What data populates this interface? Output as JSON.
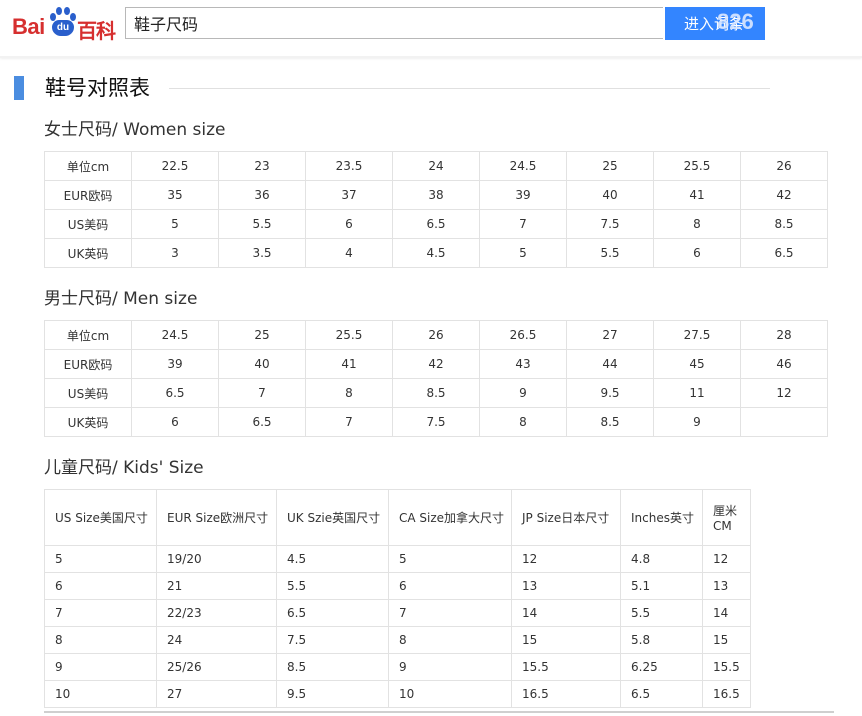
{
  "header": {
    "logo_text_left": "Bai",
    "logo_paw_text": "du",
    "logo_text_right": "百科",
    "search_value": "鞋子尺码",
    "search_button": "进入词条",
    "watermark": "826"
  },
  "section": {
    "title": "鞋号对照表"
  },
  "women": {
    "heading": "女士尺码/ Women size",
    "rows": [
      [
        "单位cm",
        "22.5",
        "23",
        "23.5",
        "24",
        "24.5",
        "25",
        "25.5",
        "26"
      ],
      [
        "EUR欧码",
        "35",
        "36",
        "37",
        "38",
        "39",
        "40",
        "41",
        "42"
      ],
      [
        "US美码",
        "5",
        "5.5",
        "6",
        "6.5",
        "7",
        "7.5",
        "8",
        "8.5"
      ],
      [
        "UK英码",
        "3",
        "3.5",
        "4",
        "4.5",
        "5",
        "5.5",
        "6",
        "6.5"
      ]
    ]
  },
  "men": {
    "heading": "男士尺码/ Men size",
    "rows": [
      [
        "单位cm",
        "24.5",
        "25",
        "25.5",
        "26",
        "26.5",
        "27",
        "27.5",
        "28"
      ],
      [
        "EUR欧码",
        "39",
        "40",
        "41",
        "42",
        "43",
        "44",
        "45",
        "46"
      ],
      [
        "US美码",
        "6.5",
        "7",
        "8",
        "8.5",
        "9",
        "9.5",
        "11",
        "12"
      ],
      [
        "UK英码",
        "6",
        "6.5",
        "7",
        "7.5",
        "8",
        "8.5",
        "9",
        ""
      ]
    ]
  },
  "kids": {
    "heading": "儿童尺码/ Kids' Size",
    "header": [
      "US Size美国尺寸",
      "EUR Size欧洲尺寸",
      "UK Szie英国尺寸",
      "CA Size加拿大尺寸",
      "JP Size日本尺寸",
      "Inches英寸",
      "厘米CM"
    ],
    "rows": [
      [
        "5",
        "19/20",
        "4.5",
        "5",
        "12",
        "4.8",
        "12"
      ],
      [
        "6",
        "21",
        "5.5",
        "6",
        "13",
        "5.1",
        "13"
      ],
      [
        "7",
        "22/23",
        "6.5",
        "7",
        "14",
        "5.5",
        "14"
      ],
      [
        "8",
        "24",
        "7.5",
        "8",
        "15",
        "5.8",
        "15"
      ],
      [
        "9",
        "25/26",
        "8.5",
        "9",
        "15.5",
        "6.25",
        "15.5"
      ],
      [
        "10",
        "27",
        "9.5",
        "10",
        "16.5",
        "6.5",
        "16.5"
      ]
    ]
  },
  "colors": {
    "brand_red": "#d62f2f",
    "brand_blue": "#2a5fcc",
    "search_button_bg": "#3385ff",
    "section_bar": "#4b8de0",
    "table_border": "#e2e2e2"
  }
}
